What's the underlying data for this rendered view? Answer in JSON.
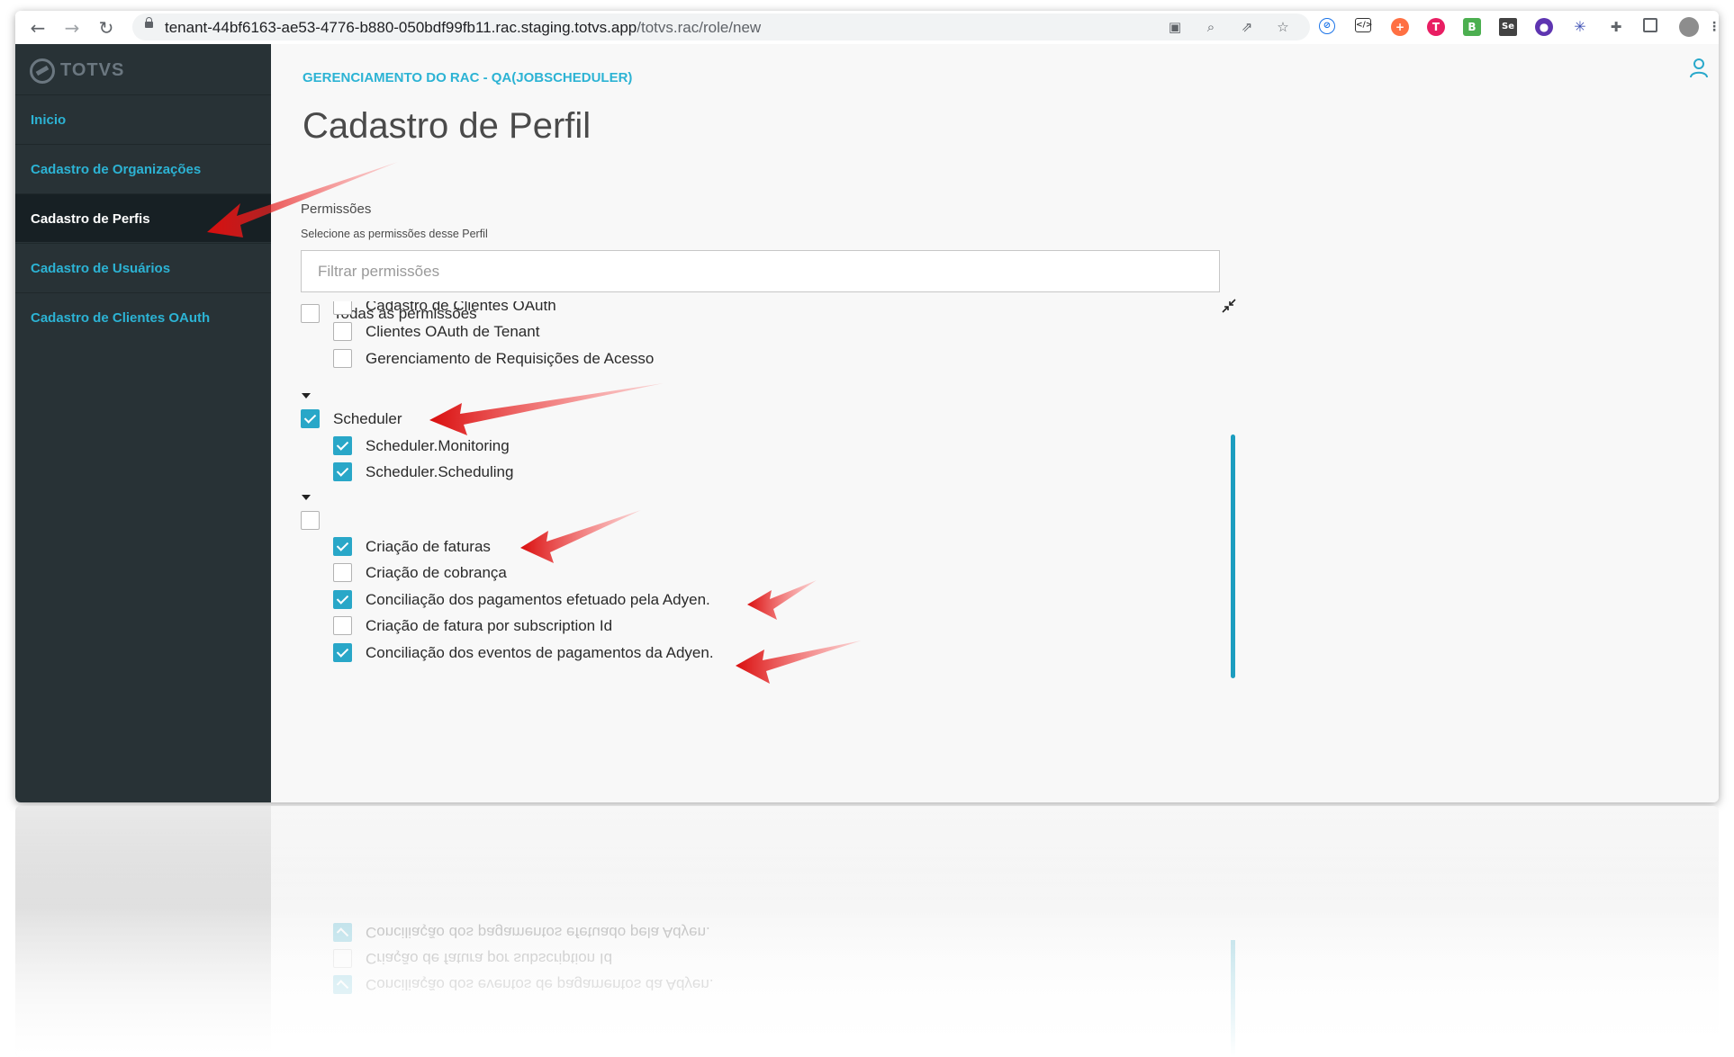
{
  "browser": {
    "url_host": "tenant-44bf6163-ae53-4776-b880-050bdf99fb11.rac.staging.totvs.app",
    "url_path": "/totvs.rac/role/new"
  },
  "sidebar": {
    "logo": "TOTVS",
    "items": [
      {
        "label": "Inicio",
        "active": false
      },
      {
        "label": "Cadastro de Organizações",
        "active": false
      },
      {
        "label": "Cadastro de Perfis",
        "active": true
      },
      {
        "label": "Cadastro de Usuários",
        "active": false
      },
      {
        "label": "Cadastro de Clientes OAuth",
        "active": false
      }
    ]
  },
  "header": {
    "breadcrumb": "GERENCIAMENTO DO RAC - QA(JOBSCHEDULER)",
    "title": "Cadastro de Perfil"
  },
  "permissions": {
    "label": "Permissões",
    "help": "Selecione as permissões desse Perfil",
    "filter_placeholder": "Filtrar permissões",
    "all_label": "Todas as permissões",
    "rac_children": [
      {
        "label": "Cadastro de Clientes OAuth",
        "checked": false
      },
      {
        "label": "Clientes OAuth de Tenant",
        "checked": false
      },
      {
        "label": "Gerenciamento de Requisições de Acesso",
        "checked": false
      }
    ],
    "scheduler": {
      "label": "Scheduler",
      "checked": true,
      "children": [
        {
          "label": "Scheduler.Monitoring",
          "checked": true
        },
        {
          "label": "Scheduler.Scheduling",
          "checked": true
        }
      ]
    },
    "billing": {
      "label": "",
      "checked": false,
      "children": [
        {
          "label": "Criação de faturas",
          "checked": true
        },
        {
          "label": "Criação de cobrança",
          "checked": false
        },
        {
          "label": "Conciliação dos pagamentos efetuado pela Adyen.",
          "checked": true
        },
        {
          "label": "Criação de fatura por subscription Id",
          "checked": false
        },
        {
          "label": "Conciliação dos eventos de pagamentos da Adyen.",
          "checked": true
        }
      ]
    }
  },
  "colors": {
    "sidebar_bg": "#283236",
    "accent": "#29a7c8",
    "link": "#2cb3d4",
    "arrow": "#e41e1e"
  }
}
